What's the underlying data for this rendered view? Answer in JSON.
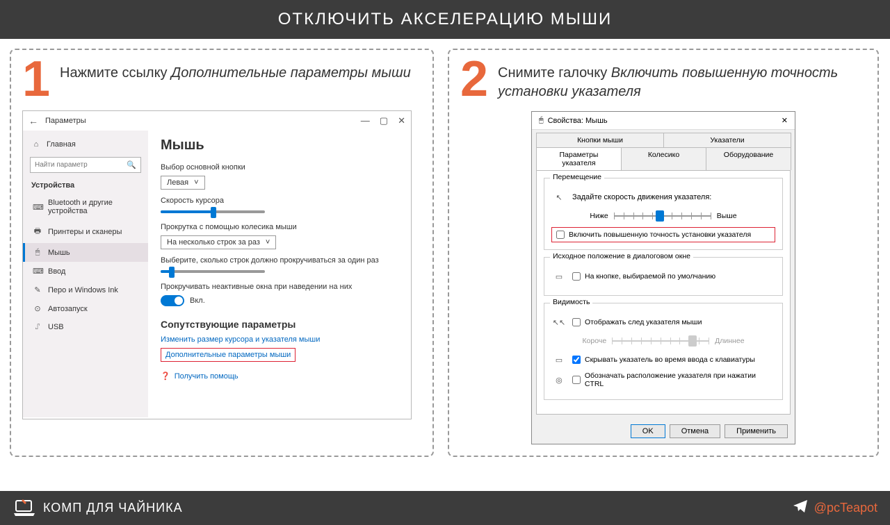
{
  "header": {
    "title": "ОТКЛЮЧИТЬ АКСЕЛЕРАЦИЮ МЫШИ"
  },
  "step1": {
    "num": "1",
    "prefix": "Нажмите ссылку ",
    "italic": "Дополнительные параметры мыши"
  },
  "step2": {
    "num": "2",
    "prefix": "Снимите галочку ",
    "italic": "Включить повышенную точность установки указателя"
  },
  "settings": {
    "title": "Параметры",
    "home": "Главная",
    "search_placeholder": "Найти параметр",
    "category": "Устройства",
    "items": [
      {
        "icon": "⌨",
        "label": "Bluetooth и другие устройства"
      },
      {
        "icon": "🖶",
        "label": "Принтеры и сканеры"
      },
      {
        "icon": "🖱",
        "label": "Мышь"
      },
      {
        "icon": "⌨",
        "label": "Ввод"
      },
      {
        "icon": "✎",
        "label": "Перо и Windows Ink"
      },
      {
        "icon": "⊙",
        "label": "Автозапуск"
      },
      {
        "icon": "⑀",
        "label": "USB"
      }
    ],
    "main": {
      "heading": "Мышь",
      "primary_button_label": "Выбор основной кнопки",
      "primary_button_value": "Левая",
      "cursor_speed_label": "Скорость курсора",
      "scroll_wheel_label": "Прокрутка с помощью колесика мыши",
      "scroll_wheel_value": "На несколько строк за раз",
      "lines_label": "Выберите, сколько строк должно прокручиваться за один раз",
      "inactive_label": "Прокручивать неактивные окна при наведении на них",
      "toggle_state": "Вкл.",
      "related_heading": "Сопутствующие параметры",
      "link1": "Изменить размер курсора и указателя мыши",
      "link2": "Дополнительные параметры мыши",
      "help": "Получить помощь"
    }
  },
  "dialog": {
    "title": "Свойства: Мышь",
    "tabs_row1": [
      "Кнопки мыши",
      "Указатели"
    ],
    "tabs_row2": [
      "Параметры указателя",
      "Колесико",
      "Оборудование"
    ],
    "group_move": {
      "title": "Перемещение",
      "speed_label": "Задайте скорость движения указателя:",
      "low": "Ниже",
      "high": "Выше",
      "enhance": "Включить повышенную точность установки указателя"
    },
    "group_snap": {
      "title": "Исходное положение в диалоговом окне",
      "label": "На кнопке, выбираемой по умолчанию"
    },
    "group_vis": {
      "title": "Видимость",
      "trails": "Отображать след указателя мыши",
      "trails_short": "Короче",
      "trails_long": "Длиннее",
      "hide": "Скрывать указатель во время ввода с клавиатуры",
      "ctrl": "Обозначать расположение указателя при нажатии CTRL"
    },
    "buttons": {
      "ok": "OK",
      "cancel": "Отмена",
      "apply": "Применить"
    }
  },
  "footer": {
    "brand": "КОМП ДЛЯ ЧАЙНИКА",
    "handle": "@pcTeapot"
  }
}
